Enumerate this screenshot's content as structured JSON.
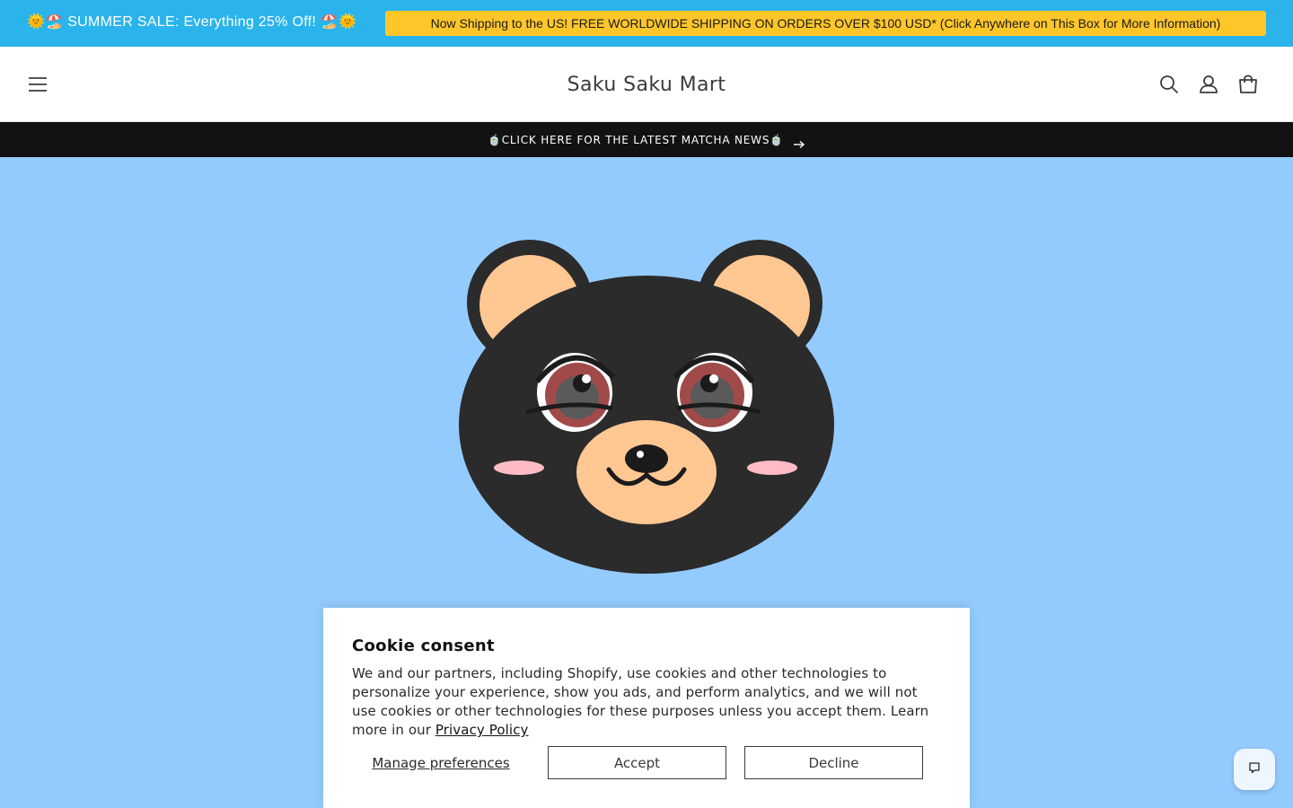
{
  "promo": {
    "sale_text": "🌞🏖️ SUMMER SALE: Everything 25% Off! 🏖️🌞",
    "shipping_text": "Now Shipping to the US! FREE WORLDWIDE SHIPPING ON ORDERS OVER $100 USD* (Click Anywhere on This Box for More Information)"
  },
  "header": {
    "brand": "Saku Saku Mart",
    "icons": [
      "menu-icon",
      "search-icon",
      "account-icon",
      "cart-icon"
    ]
  },
  "news_bar": {
    "text": "🍵CLICK HERE FOR THE LATEST MATCHA NEWS🍵",
    "icon": "arrow-right-icon"
  },
  "cookie": {
    "title": "Cookie consent",
    "body": "We and our partners, including Shopify, use cookies and other technologies to personalize your experience, show you ads, and perform analytics, and we will not use cookies or other technologies for these purposes unless you accept them. Learn more in our ",
    "privacy_link": "Privacy Policy",
    "manage_label": "Manage preferences",
    "accept_label": "Accept",
    "decline_label": "Decline"
  },
  "chat": {
    "icon": "chat-bubble-icon"
  },
  "colors": {
    "promo_bg": "#2bb4ec",
    "shipping_bg": "#ffc62a",
    "news_bg": "#121212",
    "hero_bg": "#94cbff",
    "bear_fur": "#2b2b2b",
    "bear_muzzle": "#ffc792"
  }
}
